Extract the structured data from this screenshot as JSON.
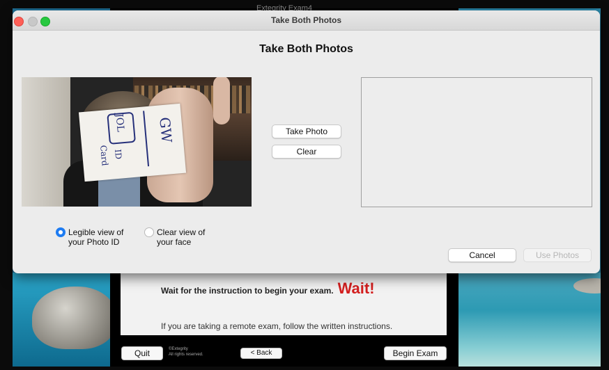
{
  "background_app": {
    "window_title": "Extegrity Exam4",
    "wait_instruction": "Wait for the instruction to begin your exam.",
    "wait_headline": "Wait!",
    "remote_instruction": "If you are taking a remote exam, follow the written instructions.",
    "quit_label": "Quit",
    "copyright_line1": "©Extegrity",
    "copyright_line2": "All rights reserved.",
    "back_label": "< Back",
    "begin_label": "Begin Exam"
  },
  "dialog": {
    "window_title": "Take Both Photos",
    "heading": "Take Both Photos",
    "take_photo_label": "Take Photo",
    "clear_label": "Clear",
    "options": [
      {
        "label_line1": "Legible view of",
        "label_line2": "your Photo ID",
        "selected": true
      },
      {
        "label_line1": "Clear view of",
        "label_line2": "your face",
        "selected": false
      }
    ],
    "cancel_label": "Cancel",
    "use_photos_label": "Use Photos"
  },
  "camera_card": {
    "initials_box": "JOL",
    "initials": "GW",
    "id_text": "ID",
    "card_text": "Card"
  },
  "colors": {
    "accent": "#1e7cf2",
    "wait_red": "#d41f1f",
    "close_button": "#fe5f57",
    "maximize_button": "#28c840"
  }
}
